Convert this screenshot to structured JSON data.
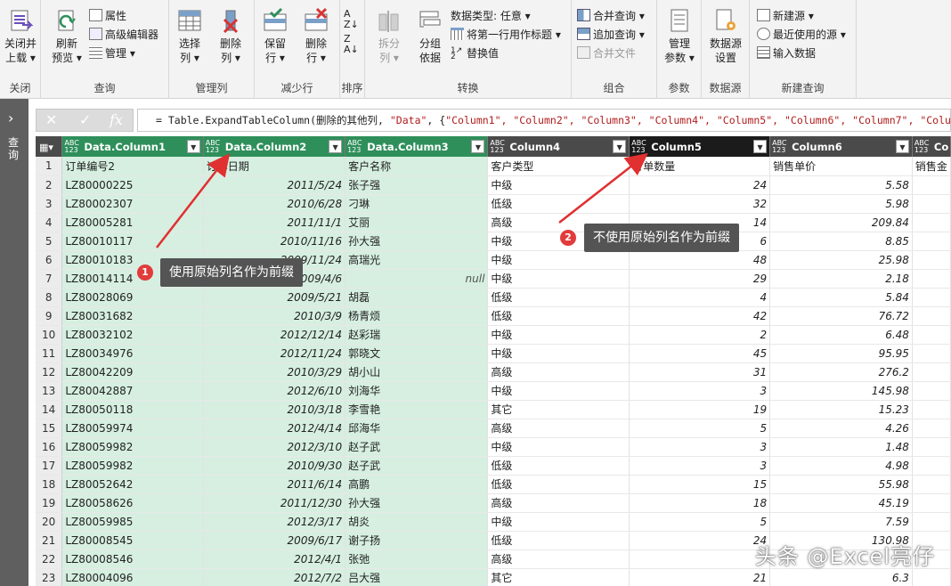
{
  "ribbon": {
    "close": {
      "btn": "关闭并\n上载",
      "label": "关闭"
    },
    "query": {
      "refresh": "刷新\n预览",
      "properties": "属性",
      "advanced_editor": "高级编辑器",
      "manage": "管理",
      "label": "查询"
    },
    "manage_columns": {
      "choose": "选择\n列",
      "remove": "删除\n列",
      "label": "管理列"
    },
    "reduce_rows": {
      "keep": "保留\n行",
      "remove": "删除\n行",
      "label": "减少行"
    },
    "sort": {
      "label": "排序"
    },
    "transform": {
      "split": "拆分\n列",
      "group_by": "分组\n依据",
      "data_type": "数据类型: 任意",
      "first_row_header": "将第一行用作标题",
      "replace_values": "替换值",
      "label": "转换"
    },
    "combine": {
      "merge": "合并查询",
      "append": "追加查询",
      "combine_files": "合并文件",
      "label": "组合"
    },
    "params": {
      "manage": "管理\n参数",
      "label": "参数"
    },
    "datasource": {
      "settings": "数据源\n设置",
      "label": "数据源"
    },
    "new_query": {
      "new_source": "新建源",
      "recent": "最近使用的源",
      "enter_data": "输入数据",
      "label": "新建查询"
    }
  },
  "leftpane": {
    "label": "查询"
  },
  "formula": {
    "prefix": "= Table.ExpandTableColumn(删除的其他列, ",
    "s1": "\"Data\"",
    "mid": ", {",
    "s2": "\"Column1\", \"Column2\", \"Column3\", \"Column4\", \"Column5\", \"Column6\", \"Column7\", \"Column8\", \"C"
  },
  "columns": [
    "Data.Column1",
    "Data.Column2",
    "Data.Column3",
    "Column4",
    "Column5",
    "Column6",
    "Co"
  ],
  "type_icon": "ABC\n123",
  "rows": [
    [
      "1",
      "订单编号2",
      "订单日期",
      "客户名称",
      "客户类型",
      "订单数量",
      "销售单价",
      "销售金"
    ],
    [
      "2",
      "LZ80000225",
      "2011/5/24",
      "张子强",
      "中级",
      "24",
      "5.58",
      ""
    ],
    [
      "3",
      "LZ80002307",
      "2010/6/28",
      "刁琳",
      "低级",
      "32",
      "5.98",
      ""
    ],
    [
      "4",
      "LZ80005281",
      "2011/11/1",
      "艾丽",
      "高级",
      "14",
      "209.84",
      ""
    ],
    [
      "5",
      "LZ80010117",
      "2010/11/16",
      "孙大强",
      "中级",
      "6",
      "8.85",
      ""
    ],
    [
      "6",
      "LZ80010183",
      "2009/11/24",
      "高瑞光",
      "中级",
      "48",
      "25.98",
      ""
    ],
    [
      "7",
      "LZ80014114",
      "2009/4/6",
      "null",
      "中级",
      "29",
      "2.18",
      ""
    ],
    [
      "8",
      "LZ80028069",
      "2009/5/21",
      "胡磊",
      "低级",
      "4",
      "5.84",
      ""
    ],
    [
      "9",
      "LZ80031682",
      "2010/3/9",
      "杨青烦",
      "低级",
      "42",
      "76.72",
      ""
    ],
    [
      "10",
      "LZ80032102",
      "2012/12/14",
      "赵彩瑞",
      "中级",
      "2",
      "6.48",
      ""
    ],
    [
      "11",
      "LZ80034976",
      "2012/11/24",
      "郭晓文",
      "中级",
      "45",
      "95.95",
      ""
    ],
    [
      "12",
      "LZ80042209",
      "2010/3/29",
      "胡小山",
      "高级",
      "31",
      "276.2",
      ""
    ],
    [
      "13",
      "LZ80042887",
      "2012/6/10",
      "刘海华",
      "中级",
      "3",
      "145.98",
      ""
    ],
    [
      "14",
      "LZ80050118",
      "2010/3/18",
      "李雪艳",
      "其它",
      "19",
      "15.23",
      ""
    ],
    [
      "15",
      "LZ80059974",
      "2012/4/14",
      "邱海华",
      "高级",
      "5",
      "4.26",
      ""
    ],
    [
      "16",
      "LZ80059982",
      "2012/3/10",
      "赵子武",
      "中级",
      "3",
      "1.48",
      ""
    ],
    [
      "17",
      "LZ80059982",
      "2010/9/30",
      "赵子武",
      "低级",
      "3",
      "4.98",
      ""
    ],
    [
      "18",
      "LZ80052642",
      "2011/6/14",
      "高鹏",
      "低级",
      "15",
      "55.98",
      ""
    ],
    [
      "19",
      "LZ80058626",
      "2011/12/30",
      "孙大强",
      "高级",
      "18",
      "45.19",
      ""
    ],
    [
      "20",
      "LZ80059985",
      "2012/3/17",
      "胡炎",
      "中级",
      "5",
      "7.59",
      ""
    ],
    [
      "21",
      "LZ80008545",
      "2009/6/17",
      "谢子扬",
      "低级",
      "24",
      "130.98",
      ""
    ],
    [
      "22",
      "LZ80008546",
      "2012/4/1",
      "张弛",
      "高级",
      "",
      "",
      ""
    ],
    [
      "23",
      "LZ80004096",
      "2012/7/2",
      "吕大强",
      "其它",
      "21",
      "6.3",
      ""
    ]
  ],
  "annotations": {
    "a1": {
      "num": "1",
      "text": "使用原始列名作为前缀"
    },
    "a2": {
      "num": "2",
      "text": "不使用原始列名作为前缀"
    }
  },
  "watermark": "头条 @Excel亮仔",
  "colors": {
    "accent_green": "#2f8f5b",
    "cell_green": "#d6efe0",
    "arrow_red": "#e03030",
    "header_dark": "#4a4a4a"
  }
}
